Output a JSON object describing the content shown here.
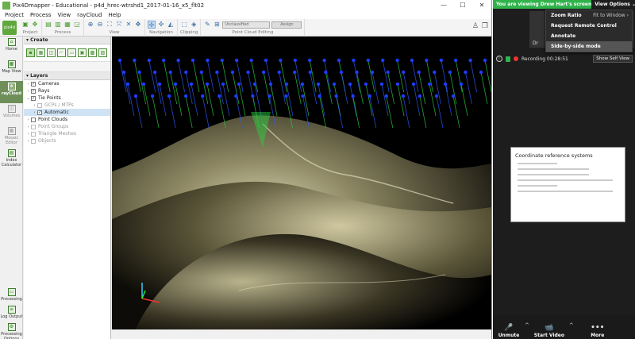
{
  "app": {
    "title": "Pix4Dmapper - Educational - p4d_hrec-wtrshd1_2017-01-16_x5_flt02",
    "window_controls": [
      "—",
      "☐",
      "✕"
    ]
  },
  "menu": [
    "Project",
    "Process",
    "View",
    "rayCloud",
    "Help"
  ],
  "toolbar": {
    "logo": "pix4d",
    "groups": [
      "Project",
      "Process",
      "View",
      "Navigation",
      "Clipping",
      "Point Cloud Editing"
    ],
    "class_select": "Unclassified",
    "assign_label": "Assign"
  },
  "left_nav": [
    {
      "label": "Home"
    },
    {
      "label": "Map View"
    },
    {
      "label": "rayCloud",
      "active": true
    },
    {
      "label": "Volumes"
    },
    {
      "label": "Mosaic Editor"
    },
    {
      "label": "Index Calculator"
    }
  ],
  "left_nav_bottom": [
    {
      "label": "Processing"
    },
    {
      "label": "Log Output"
    },
    {
      "label": "Processing Options"
    }
  ],
  "panel": {
    "create_title": "Create",
    "layers_title": "Layers",
    "layers": [
      {
        "label": "Cameras",
        "checked": true,
        "indent": 0,
        "gray": false
      },
      {
        "label": "Rays",
        "checked": true,
        "indent": 0,
        "gray": false
      },
      {
        "label": "Tie Points",
        "checked": true,
        "indent": 0,
        "gray": false,
        "expanded": true
      },
      {
        "label": "GCPs / MTPs",
        "checked": false,
        "indent": 1,
        "gray": true
      },
      {
        "label": "Automatic",
        "checked": true,
        "indent": 1,
        "gray": false,
        "selected": true
      },
      {
        "label": "Point Clouds",
        "checked": false,
        "indent": 0,
        "gray": false
      },
      {
        "label": "Point Groups",
        "checked": false,
        "indent": 0,
        "gray": true
      },
      {
        "label": "Triangle Meshes",
        "checked": false,
        "indent": 0,
        "gray": true
      },
      {
        "label": "Objects",
        "checked": false,
        "indent": 0,
        "gray": true
      }
    ]
  },
  "zoom": {
    "banner": "You are viewing Drew Hart's screen",
    "view_options": "View Options ⌄",
    "menu": [
      {
        "label": "Zoom Ratio",
        "sub": "Fit to Window ›"
      },
      {
        "label": "Request Remote Control",
        "sub": ""
      },
      {
        "label": "Annotate",
        "sub": ""
      },
      {
        "label": "Side-by-side mode",
        "sub": "",
        "highlight": true
      }
    ],
    "thumb_name": "Dr",
    "recording": "Recording 00:28:51",
    "show_self_view": "Show Self View",
    "shared_title": "Coordinate reference systems",
    "bar": [
      {
        "label": "Unmute",
        "icon": "🎤"
      },
      {
        "label": "Start Video",
        "icon": "📹"
      },
      {
        "label": "More",
        "icon": "•••"
      }
    ]
  }
}
